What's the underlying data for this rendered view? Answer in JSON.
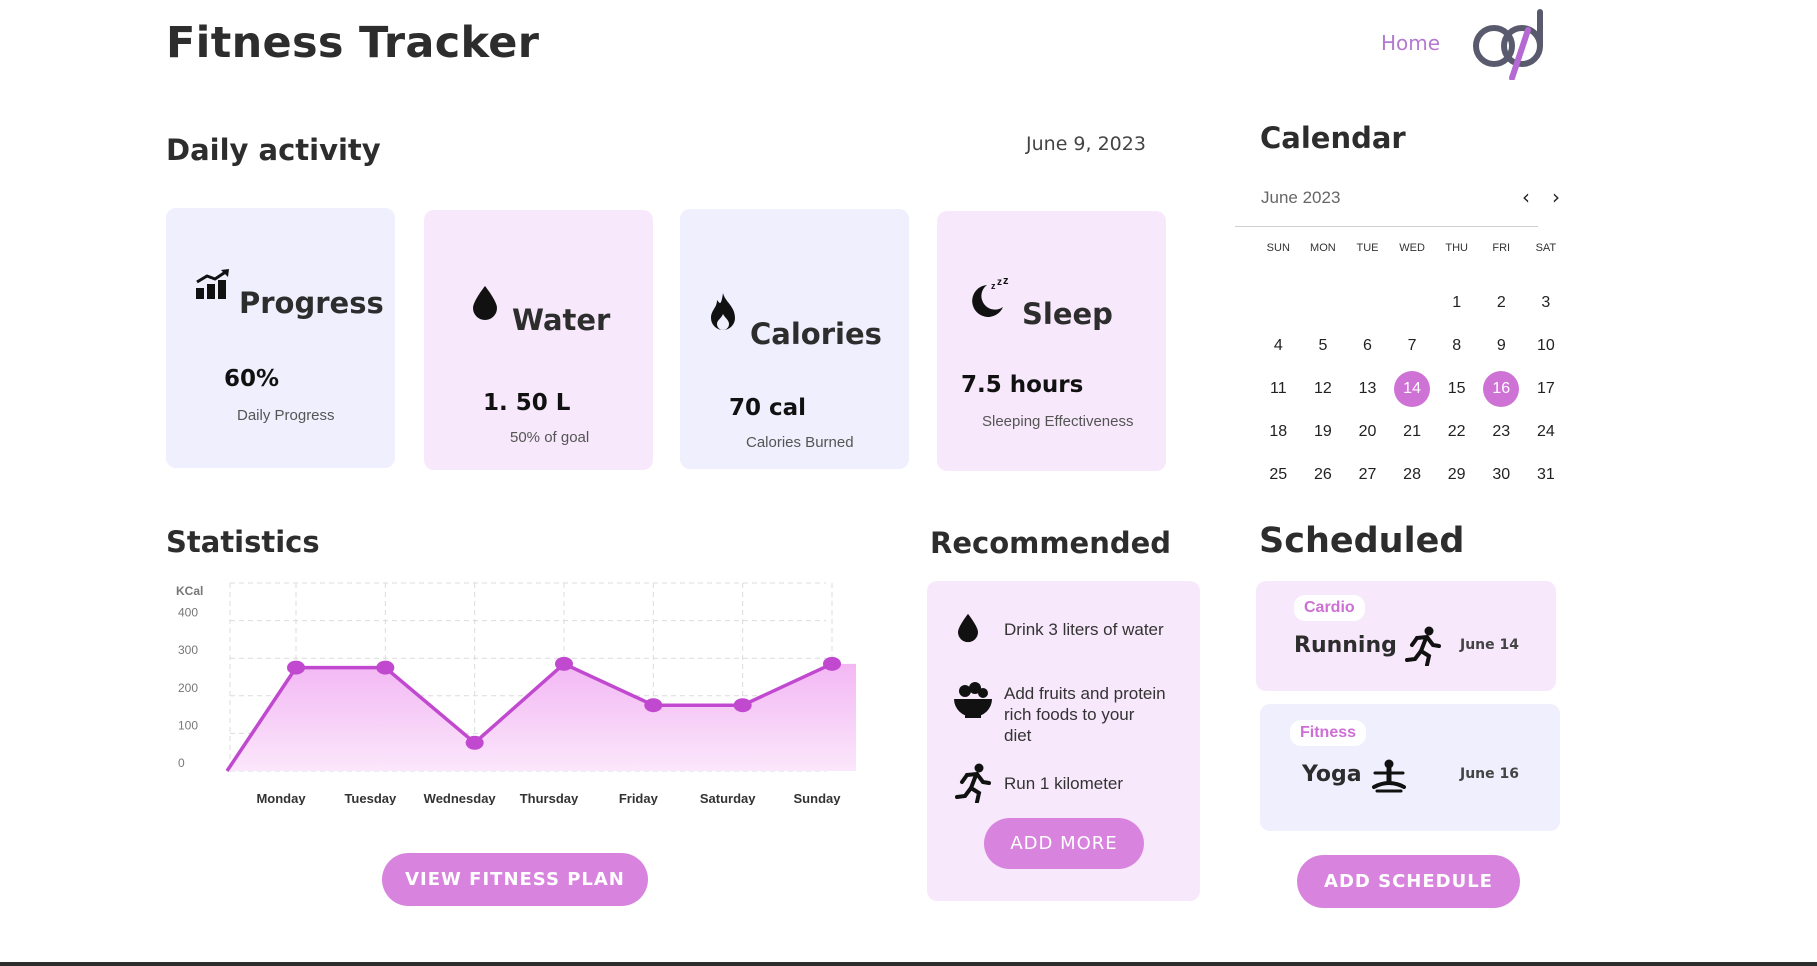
{
  "header": {
    "app_title": "Fitness Tracker",
    "nav_home": "Home",
    "logo_icon": "infinity-logo"
  },
  "daily": {
    "title": "Daily activity",
    "date": "June 9, 2023",
    "cards": [
      {
        "icon": "progress-chart-icon",
        "title": "Progress",
        "value": "60%",
        "sub": "Daily Progress"
      },
      {
        "icon": "water-drop-icon",
        "title": "Water",
        "value": "1. 50 L",
        "sub": "50% of goal"
      },
      {
        "icon": "flame-icon",
        "title": "Calories",
        "value": "70 cal",
        "sub": "Calories Burned"
      },
      {
        "icon": "moon-sleep-icon",
        "title": "Sleep",
        "value": "7.5 hours",
        "sub": "Sleeping Effectiveness"
      }
    ]
  },
  "calendar": {
    "title": "Calendar",
    "month": "June 2023",
    "prev": "‹",
    "next": "›",
    "weekdays": [
      "SUN",
      "MON",
      "TUE",
      "WED",
      "THU",
      "FRI",
      "SAT"
    ],
    "days": [
      "1",
      "2",
      "3",
      "4",
      "5",
      "6",
      "7",
      "8",
      "9",
      "10",
      "11",
      "12",
      "13",
      "14",
      "15",
      "16",
      "17",
      "18",
      "19",
      "20",
      "21",
      "22",
      "23",
      "24",
      "25",
      "26",
      "27",
      "28",
      "29",
      "30",
      "31"
    ],
    "selected_days": [
      "14",
      "16"
    ],
    "accent": "#cf72d6"
  },
  "statistics": {
    "title": "Statistics",
    "button": "VIEW FITNESS PLAN"
  },
  "chart_data": {
    "type": "area",
    "ylabel": "KCal",
    "yticks": [
      0,
      100,
      200,
      300,
      400
    ],
    "ylim": [
      0,
      500
    ],
    "categories": [
      "Monday",
      "Tuesday",
      "Wednesday",
      "Thursday",
      "Friday",
      "Saturday",
      "Sunday"
    ],
    "series": [
      {
        "values": [
          275,
          275,
          75,
          285,
          175,
          175,
          285
        ],
        "color": "#c049cf"
      }
    ],
    "start_value": 0,
    "grid": true
  },
  "recommended": {
    "title": "Recommended",
    "items": [
      {
        "icon": "water-drop-icon",
        "lines": [
          "Drink 3 liters of water"
        ]
      },
      {
        "icon": "fruit-bowl-icon",
        "lines": [
          "Add fruits and protein",
          "rich foods  to your",
          "diet"
        ]
      },
      {
        "icon": "running-icon",
        "lines": [
          "Run 1 kilometer"
        ]
      }
    ],
    "button": "ADD MORE"
  },
  "scheduled": {
    "title": "Scheduled",
    "items": [
      {
        "tag": "Cardio",
        "name": "Running",
        "icon": "running-icon",
        "date": "June 14"
      },
      {
        "tag": "Fitness",
        "name": "Yoga",
        "icon": "yoga-icon",
        "date": "June 16"
      }
    ],
    "button": "ADD SCHEDULE"
  }
}
